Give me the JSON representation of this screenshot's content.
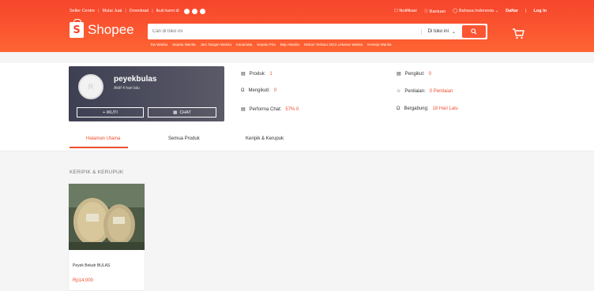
{
  "topbar": {
    "seller_centre": "Seller Centre",
    "mulai_jual": "Mulai Jual",
    "download": "Download",
    "ikuti_kami": "Ikuti kami di",
    "notifikasi": "Notifikasi",
    "bantuan": "Bantuan",
    "bahasa": "Bahasa Indonesia",
    "daftar": "Daftar",
    "login": "Log In"
  },
  "brand": {
    "name": "Shopee"
  },
  "search": {
    "placeholder": "Cari di toko ini",
    "scope": "Di toko ini",
    "keywords": [
      "Tas Wanita",
      "Sepatu Wanita",
      "Jam Tangan Wanita",
      "Kacamata",
      "Sepatu Pria",
      "Baju Wanita",
      "Diskon Terbaru 2023 Lebaran Wanita",
      "Kemeja Wanita"
    ]
  },
  "shop": {
    "name": "peyekbulas",
    "status": "Aktif 4 hari lalu",
    "follow_label": "+ IKUTI",
    "chat_label": "CHAT"
  },
  "stats": {
    "produk_label": "Produk:",
    "produk_value": "1",
    "mengikuti_label": "Mengikuti:",
    "mengikuti_value": "0",
    "performa_label": "Performa Chat:",
    "performa_value": "57% 0",
    "pengikut_label": "Pengikut:",
    "pengikut_value": "0",
    "penilaian_label": "Penilaian:",
    "penilaian_value": "0 Penilaian",
    "bergabung_label": "Bergabung:",
    "bergabung_value": "18 Hari Lalu"
  },
  "tabs": [
    {
      "label": "Halaman Utama",
      "active": true
    },
    {
      "label": "Semua Produk",
      "active": false
    },
    {
      "label": "Keripik & Kerupuk",
      "active": false
    }
  ],
  "section": {
    "title": "KERIPIK & KERUPUK"
  },
  "product": {
    "name": "Peyek Bekah BULAS",
    "price": "Rp14.000"
  },
  "colors": {
    "brand": "#ee4d2d",
    "header_top": "#f6452c",
    "header_bottom": "#fe6433"
  }
}
